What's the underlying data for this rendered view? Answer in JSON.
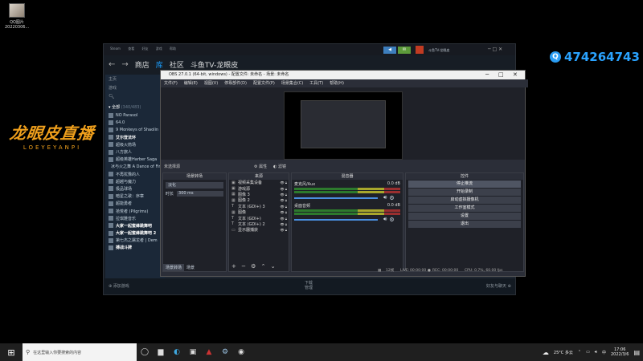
{
  "desktop_icon": {
    "label_line1": "QQ图片",
    "label_line2": "20220306..."
  },
  "logo": {
    "main": "龙眼皮直播",
    "sub": "LOEYEYANPI"
  },
  "qq_badge": {
    "number": "474264743"
  },
  "steam": {
    "topbar": [
      "Steam",
      "查看",
      "好友",
      "游戏",
      "帮助"
    ],
    "notify_user": "斗鱼TV-龙眼皮",
    "nav": {
      "store": "商店",
      "library": "库",
      "community": "社区",
      "profile": "斗鱼TV-龙眼皮"
    },
    "side_header": "主页",
    "side_games_label": "游戏",
    "category": "全部",
    "category_count": "(340/483)",
    "games": [
      "NO Parasol",
      "64.0",
      "9 Monkeys of Shaolin",
      "艾尔登法环",
      "超级火箭场",
      "八方旅人",
      "超级英雄Harber Saga",
      "冰与火之舞 A Dance of Fire...",
      "不再犹豫的人",
      "超越与魔力",
      "极品球场",
      "暗星之歌：序章",
      "超能勇者",
      "拾荒者 (Pilgrims)",
      "拉琪雅音乐",
      "大家一起蜜蜂跳舞吧",
      "大家一起蜜蜂跳舞吧 2",
      "第七杰之屠龙者 | Dem",
      "搏战斗牌"
    ],
    "bottom_left": "添加游戏",
    "bottom_center_1": "下载",
    "bottom_center_2": "管理",
    "bottom_right": "好友与聊天"
  },
  "obs": {
    "title": "OBS 27.0.1 (64-bit, windows) - 配置文件: 未命名 - 场景: 未命名",
    "menu": [
      "文件(F)",
      "编辑(E)",
      "视图(V)",
      "停靠部件(D)",
      "配置文件(P)",
      "场景集合(C)",
      "工具(T)",
      "帮助(H)"
    ],
    "no_source": "未选择源",
    "props": "属性",
    "filters": "滤镜",
    "docks": {
      "transitions": "场景转场",
      "sources": "来源",
      "mixer": "混音器",
      "controls": "控件"
    },
    "transition_type": "淡化",
    "duration_label": "时长",
    "duration_value": "300 ms",
    "sources": [
      {
        "icon": "▣",
        "name": "视频采集设备"
      },
      {
        "icon": "▣",
        "name": "游戏源"
      },
      {
        "icon": "▦",
        "name": "图像 3"
      },
      {
        "icon": "▦",
        "name": "图像 2"
      },
      {
        "icon": "T",
        "name": "文本 (GDI+) 3"
      },
      {
        "icon": "▦",
        "name": "图像"
      },
      {
        "icon": "T",
        "name": "文本 (GDI+)"
      },
      {
        "icon": "T",
        "name": "文本 (GDI+) 2"
      },
      {
        "icon": "▭",
        "name": "显示器捕获"
      }
    ],
    "mixer": [
      {
        "name": "麦克风/Aux",
        "db": "0.0 dB"
      },
      {
        "name": "桌面音频",
        "db": "0.0 dB"
      }
    ],
    "controls": [
      "停止推流",
      "开始录制",
      "启动虚拟摄像机",
      "工作室模式",
      "设置",
      "退出"
    ],
    "tabs": [
      "场景转场",
      "场景"
    ],
    "status": {
      "drop": "12帧",
      "live": "LIVE:",
      "live_t": "00:00:00",
      "rec": "REC:",
      "rec_t": "00:00:00",
      "cpu": "CPU: 0.7%, 60.00 fps"
    }
  },
  "taskbar": {
    "search_placeholder": "在这里输入你要搜索的内容",
    "weather": "25°C 多云",
    "time": "17:06",
    "date": "2022/3/6"
  }
}
